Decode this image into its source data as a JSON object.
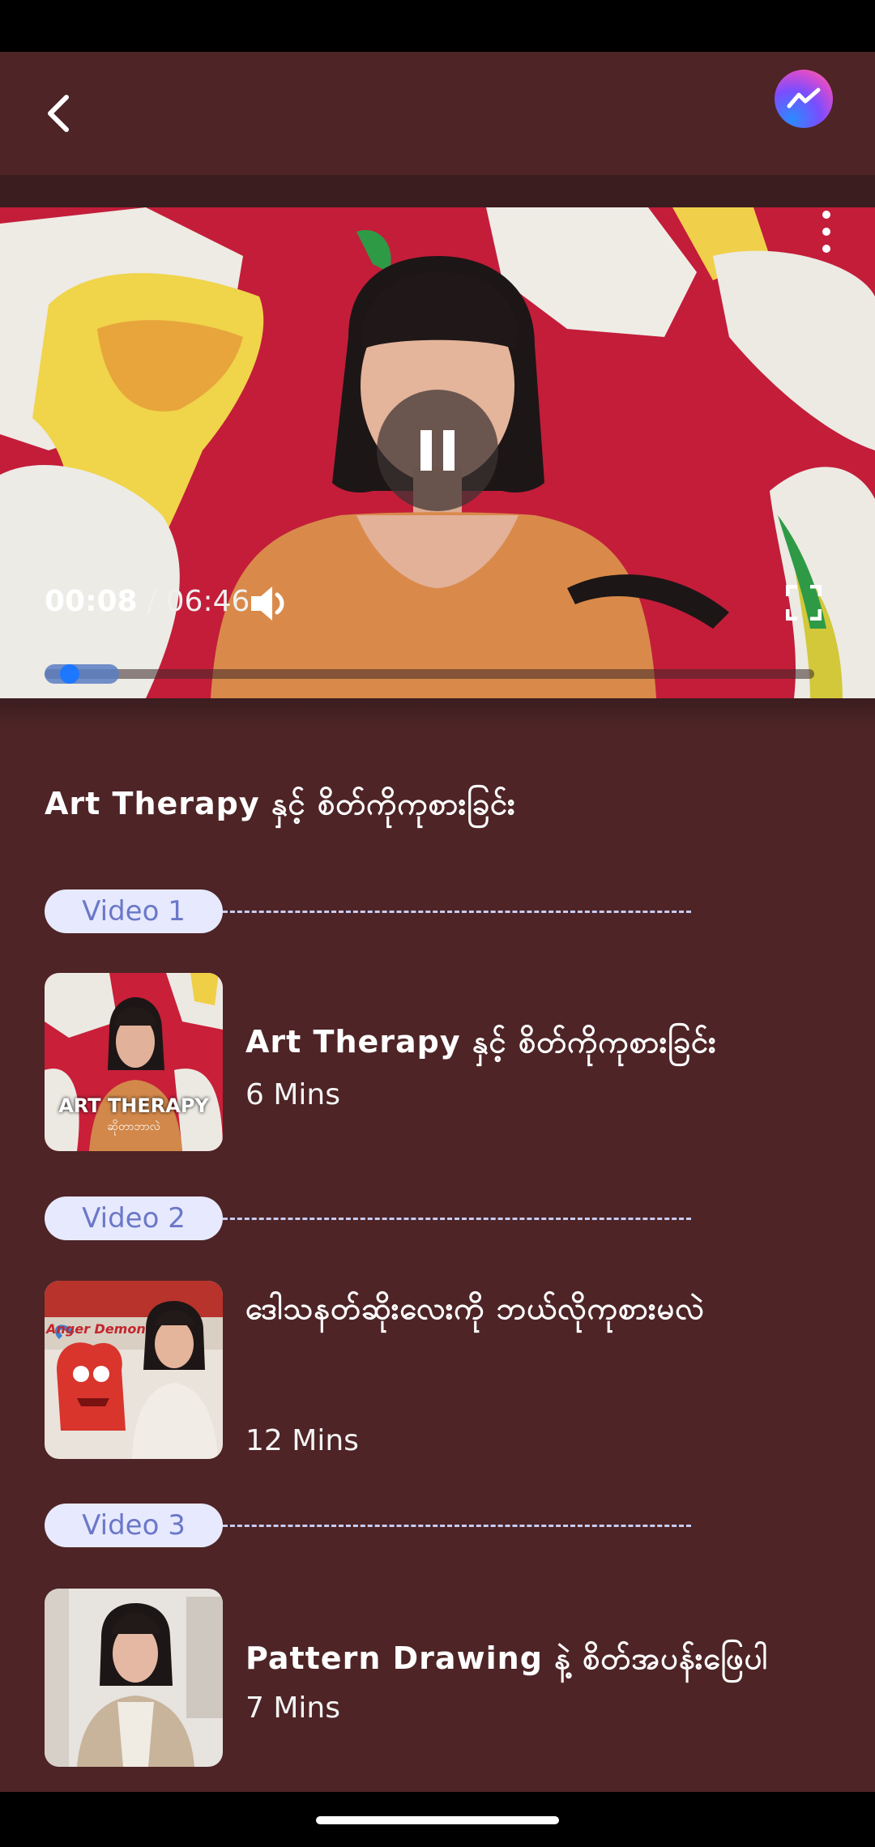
{
  "app_bar": {
    "back_icon": "chevron-left-icon",
    "messenger_icon": "messenger-icon",
    "messenger_color": "#7b4dff"
  },
  "player": {
    "current_time": "00:08",
    "separator": "/",
    "duration": "06:46",
    "progress": 0.02,
    "state_icon": "pause-icon",
    "volume_icon": "volume-icon",
    "fullscreen_icon": "fullscreen-icon",
    "menu_icon": "more-vertical-icon",
    "thumb_color": "#1e78ff"
  },
  "course": {
    "title": "Art Therapy နှင့် စိတ်ကိုကုစားခြင်း"
  },
  "videos": [
    {
      "label": "Video 1",
      "title": "Art Therapy နှင့် စိတ်ကိုကုစားခြင်း",
      "duration": "6 Mins",
      "thumbnail_text": "ART THERAPY",
      "thumbnail_subtext": "ဆိုတာဘာလဲ"
    },
    {
      "label": "Video 2",
      "title": "ဒေါသနတ်ဆိုးလေးကို ဘယ်လိုကုစားမလဲ",
      "duration": "12 Mins",
      "thumbnail_text": "Anger Demon"
    },
    {
      "label": "Video 3",
      "title": "Pattern Drawing နဲ့ စိတ်အပန်းဖြေပါ",
      "duration": "7 Mins"
    }
  ]
}
